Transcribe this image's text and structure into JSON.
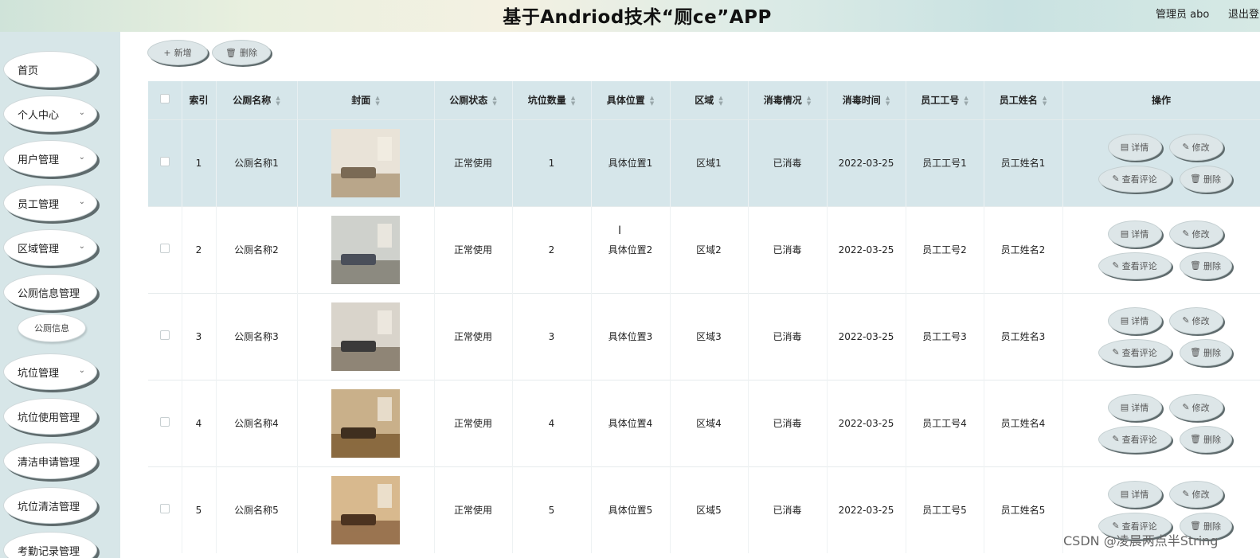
{
  "header": {
    "title": "基于Andriod技术“厕ce”APP",
    "user": "管理员 abo",
    "logout": "退出登"
  },
  "sidebar": {
    "items": [
      {
        "label": "首页",
        "arrow": false
      },
      {
        "label": "个人中心",
        "arrow": true
      },
      {
        "label": "用户管理",
        "arrow": true
      },
      {
        "label": "员工管理",
        "arrow": true
      },
      {
        "label": "区域管理",
        "arrow": true
      },
      {
        "label": "公厕信息管理",
        "arrow": false
      },
      {
        "label": "坑位管理",
        "arrow": true
      },
      {
        "label": "坑位使用管理",
        "arrow": false
      },
      {
        "label": "清洁申请管理",
        "arrow": false
      },
      {
        "label": "坑位清洁管理",
        "arrow": false
      },
      {
        "label": "考勤记录管理",
        "arrow": false
      }
    ],
    "subitem": "公厕信息"
  },
  "toolbar": {
    "add_label": "新增",
    "delete_label": "删除"
  },
  "table": {
    "columns": [
      "索引",
      "公厕名称",
      "封面",
      "公厕状态",
      "坑位数量",
      "具体位置",
      "区域",
      "消毒情况",
      "消毒时间",
      "员工工号",
      "员工姓名",
      "操作"
    ],
    "rows": [
      {
        "index": "1",
        "name": "公厕名称1",
        "status": "正常使用",
        "count": "1",
        "location": "具体位置1",
        "area": "区域1",
        "disinfect": "已消毒",
        "time": "2022-03-25",
        "emp_no": "员工工号1",
        "emp_name": "员工姓名1"
      },
      {
        "index": "2",
        "name": "公厕名称2",
        "status": "正常使用",
        "count": "2",
        "location": "具体位置2",
        "area": "区域2",
        "disinfect": "已消毒",
        "time": "2022-03-25",
        "emp_no": "员工工号2",
        "emp_name": "员工姓名2"
      },
      {
        "index": "3",
        "name": "公厕名称3",
        "status": "正常使用",
        "count": "3",
        "location": "具体位置3",
        "area": "区域3",
        "disinfect": "已消毒",
        "time": "2022-03-25",
        "emp_no": "员工工号3",
        "emp_name": "员工姓名3"
      },
      {
        "index": "4",
        "name": "公厕名称4",
        "status": "正常使用",
        "count": "4",
        "location": "具体位置4",
        "area": "区域4",
        "disinfect": "已消毒",
        "time": "2022-03-25",
        "emp_no": "员工工号4",
        "emp_name": "员工姓名4"
      },
      {
        "index": "5",
        "name": "公厕名称5",
        "status": "正常使用",
        "count": "5",
        "location": "具体位置5",
        "area": "区域5",
        "disinfect": "已消毒",
        "time": "2022-03-25",
        "emp_no": "员工工号5",
        "emp_name": "员工姓名5"
      }
    ],
    "actions": {
      "detail": "详情",
      "edit": "修改",
      "review": "查看评论",
      "delete": "删除"
    }
  },
  "watermark": "CSDN @凌晨两点半String",
  "colors": {
    "header_bg": "#dcebe6",
    "sidebar_bg": "#d7e6e8",
    "table_header_bg": "#d6e6ea",
    "button_bg": "#dde6e8",
    "button_shadow": "#5f6b6d"
  }
}
